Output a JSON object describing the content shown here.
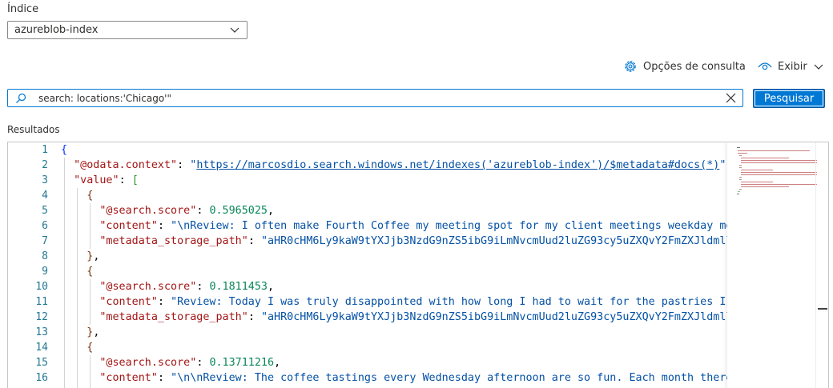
{
  "index": {
    "label": "Índice",
    "selected": "azureblob-index"
  },
  "toolbar": {
    "query_options": "Opções de consulta",
    "view": "Exibir"
  },
  "search": {
    "value": "search: locations:'Chicago'\"",
    "button": "Pesquisar"
  },
  "results": {
    "label": "Resultados",
    "line_numbers": [
      "1",
      "2",
      "3",
      "4",
      "5",
      "6",
      "7",
      "8",
      "9",
      "10",
      "11",
      "12",
      "13",
      "14",
      "15",
      "16"
    ],
    "odata_key": "\"@odata.context\"",
    "odata_url": "https://marcosdio.search.windows.net/indexes('azureblob-index')/$metadata#docs(*)",
    "value_key": "\"value\"",
    "score_key": "\"@search.score\"",
    "content_key": "\"content\"",
    "path_key": "\"metadata_storage_path\"",
    "scores": [
      "0.5965025",
      "0.1811453",
      "0.13711216"
    ],
    "contents": [
      "\"\\nReview: I often make Fourth Coffee my meeting spot for my client meetings weekday mo",
      "\"Review: Today I was truly disappointed with how long I had to wait for the pastries I",
      "\"\\n\\nReview: The coffee tastings every Wednesday afternoon are so fun. Each month there"
    ],
    "paths": [
      "\"aHR0cHM6Ly9kaW9tYXJjb3NzdG9nZS5ibG9iLmNvcmUud2luZG93cy5uZXQvY2FmZXJldmll",
      "\"aHR0cHM6Ly9kaW9tYXJjb3NzdG9nZS5ibG9iLmNvcmUud2luZG93cy5uZXQvY2FmZXJldmll"
    ]
  }
}
